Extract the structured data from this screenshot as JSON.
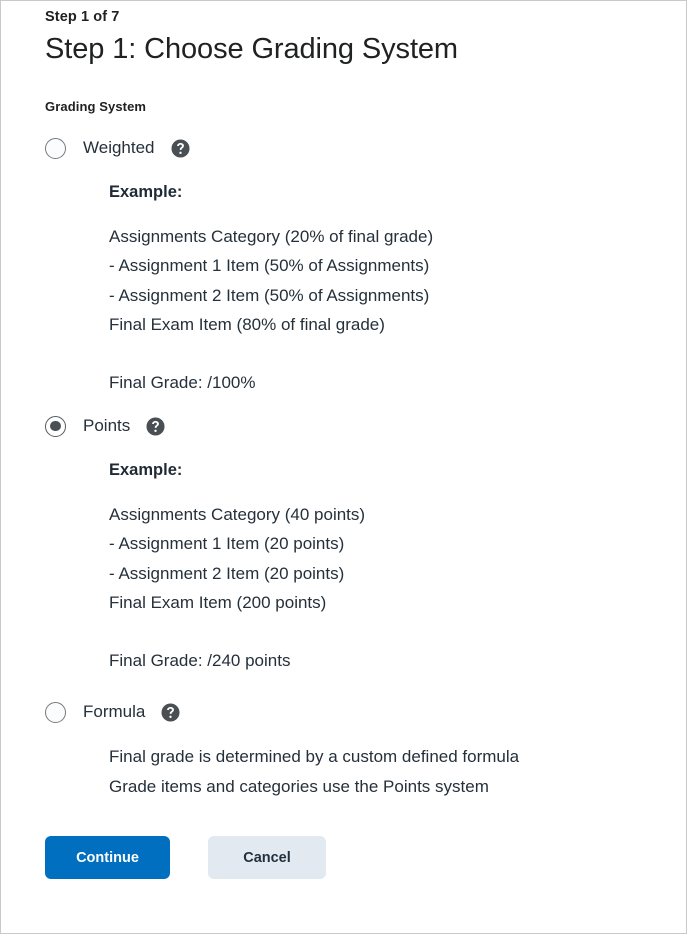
{
  "header": {
    "eyebrow": "Step 1 of 7",
    "title": "Step 1: Choose Grading System"
  },
  "field": {
    "label": "Grading System"
  },
  "colors": {
    "primary_button": "#006fbf",
    "secondary_button": "#e3e9f0",
    "text": "#25303b",
    "border": "#c9c9c9",
    "radio_border": "#76797c",
    "help_icon": "#4a4f53"
  },
  "options": [
    {
      "id": "weighted",
      "label": "Weighted",
      "selected": false,
      "help_icon": "help-circle-icon",
      "example_heading": "Example:",
      "example_lines": [
        "Assignments Category (20% of final grade)",
        "- Assignment 1 Item (50% of Assignments)",
        "- Assignment 2 Item (50% of Assignments)",
        "Final Exam Item (80% of final grade)"
      ],
      "final_grade": "Final Grade: /100%"
    },
    {
      "id": "points",
      "label": "Points",
      "selected": true,
      "help_icon": "help-circle-icon",
      "example_heading": "Example:",
      "example_lines": [
        "Assignments Category (40 points)",
        "- Assignment 1 Item (20 points)",
        "- Assignment 2 Item (20 points)",
        "Final Exam Item (200 points)"
      ],
      "final_grade": "Final Grade: /240 points"
    },
    {
      "id": "formula",
      "label": "Formula",
      "selected": false,
      "help_icon": "help-circle-icon",
      "description_lines": [
        "Final grade is determined by a custom defined formula",
        "Grade items and categories use the Points system"
      ]
    }
  ],
  "actions": {
    "continue_label": "Continue",
    "cancel_label": "Cancel"
  }
}
